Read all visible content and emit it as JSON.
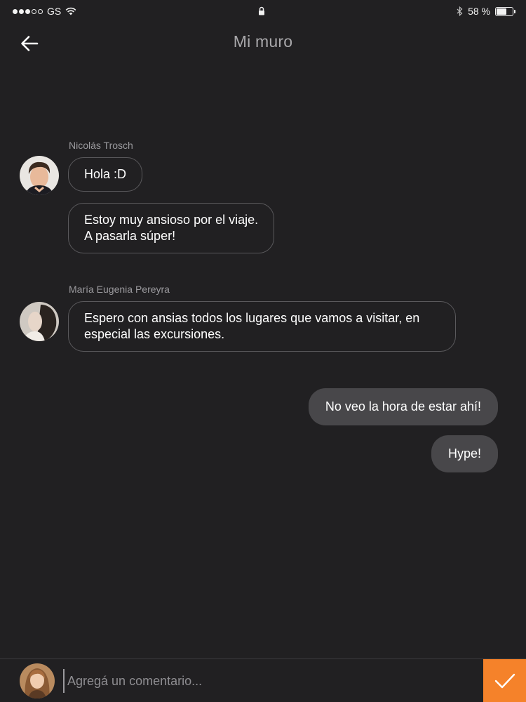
{
  "status_bar": {
    "carrier": "GS",
    "battery_text": "58 %",
    "battery_level": 0.58,
    "signal_bars_filled": 3,
    "signal_bars_total": 5
  },
  "header": {
    "title": "Mi muro",
    "back_icon": "arrow-left-icon"
  },
  "messages": [
    {
      "sender": "Nicolás Trosch",
      "direction": "incoming",
      "bubbles": [
        "Hola :D",
        "Estoy muy ansioso por el viaje.\nA pasarla súper!"
      ]
    },
    {
      "sender": "María Eugenia Pereyra",
      "direction": "incoming",
      "bubbles": [
        "Espero con ansias todos los lugares que vamos a visitar, en especial las excursiones."
      ]
    },
    {
      "sender": "",
      "direction": "outgoing",
      "bubbles": [
        "No veo la hora de estar ahí!",
        "Hype!"
      ]
    }
  ],
  "composer": {
    "placeholder": "Agregá un comentario...",
    "send_icon": "checkmark-icon"
  },
  "colors": {
    "background": "#212022",
    "accent": "#f5822a",
    "outgoing_bubble": "#48474a",
    "incoming_border": "#5a595c"
  }
}
